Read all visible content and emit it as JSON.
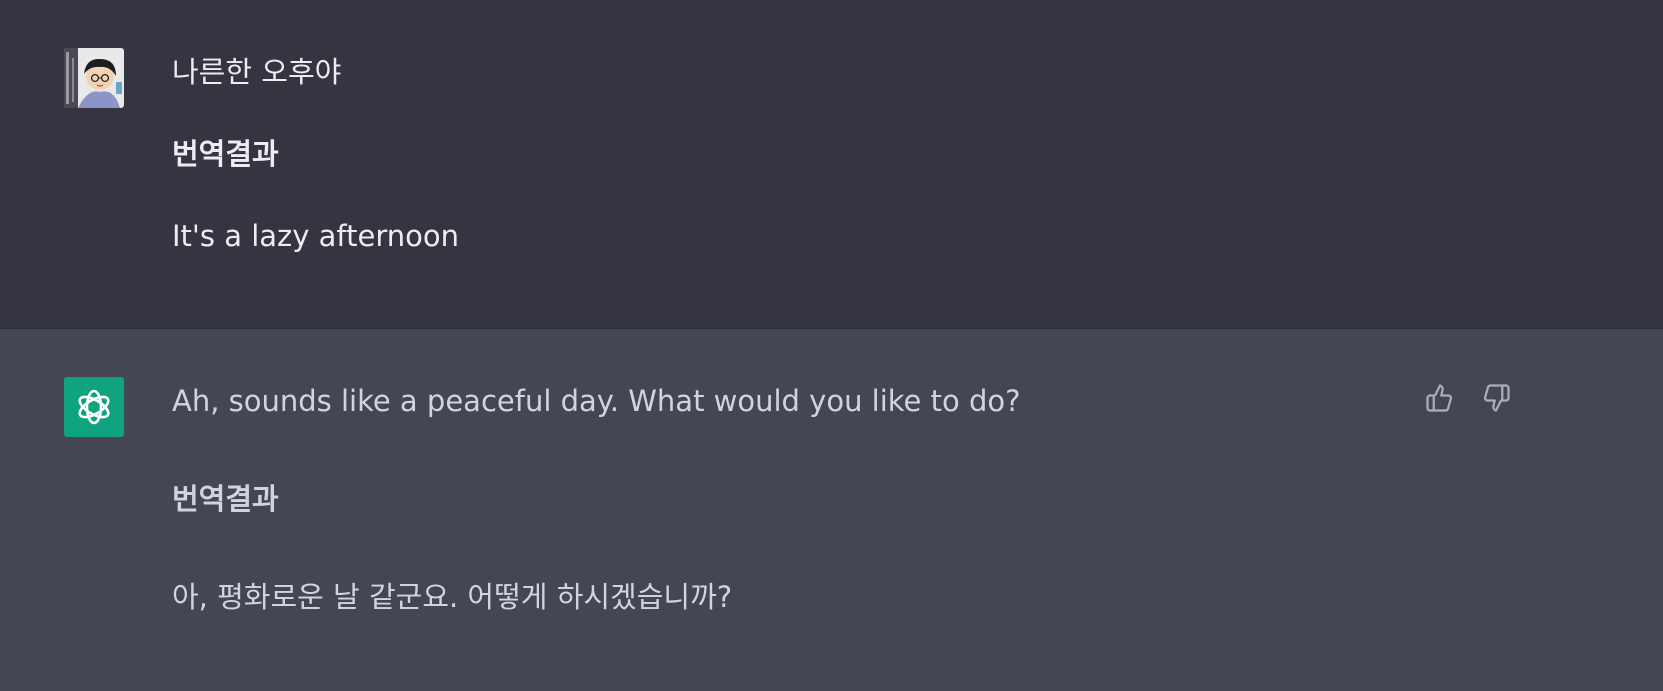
{
  "messages": {
    "user": {
      "original": "나른한 오후야",
      "translation_heading": "번역결과",
      "translation": "It's a lazy afternoon"
    },
    "assistant": {
      "original": "Ah, sounds like a peaceful day. What would you like to do?",
      "translation_heading": "번역결과",
      "translation": "아, 평화로운 날 같군요. 어떻게 하시겠습니까?"
    }
  },
  "icons": {
    "user_avatar": "user-avatar-photo",
    "assistant_avatar": "openai-logo-icon",
    "thumbs_up": "thumbs-up-icon",
    "thumbs_down": "thumbs-down-icon"
  },
  "colors": {
    "user_bg": "#343541",
    "assistant_bg": "#444654",
    "assistant_avatar_bg": "#10a37f",
    "text": "#ececf1",
    "icon": "#acacbe"
  }
}
